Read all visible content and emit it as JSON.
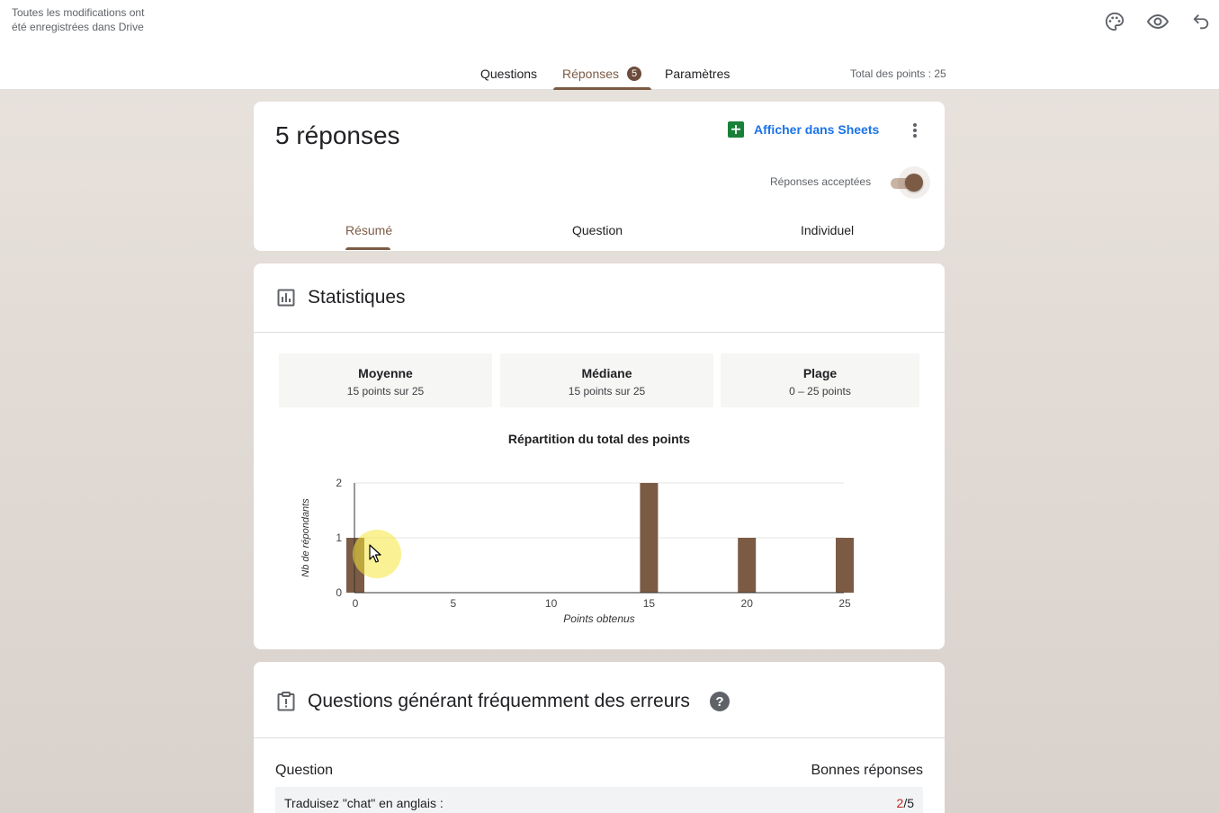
{
  "header": {
    "save_status": "Toutes les modifications ont été enregistrées dans Drive",
    "tabs": [
      {
        "label": "Questions"
      },
      {
        "label": "Réponses",
        "badge": "5"
      },
      {
        "label": "Paramètres"
      }
    ],
    "total_points": "Total des points : 25",
    "icons": [
      "palette-icon",
      "eye-icon",
      "undo-icon"
    ]
  },
  "responses": {
    "count_title": "5 réponses",
    "sheets_label": "Afficher dans Sheets",
    "accept_label": "Réponses acceptées",
    "accepting": true,
    "subtabs": [
      "Résumé",
      "Question",
      "Individuel"
    ],
    "active_subtab": "Résumé"
  },
  "stats": {
    "title": "Statistiques",
    "boxes": [
      {
        "name": "Moyenne",
        "value": "15 points sur 25"
      },
      {
        "name": "Médiane",
        "value": "15 points sur 25"
      },
      {
        "name": "Plage",
        "value": "0 – 25 points"
      }
    ]
  },
  "chart_data": {
    "type": "bar",
    "title": "Répartition du total des points",
    "xlabel": "Points obtenus",
    "ylabel": "Nb de répondants",
    "x": [
      0,
      15,
      20,
      25
    ],
    "values": [
      1,
      2,
      1,
      1
    ],
    "x_ticks": [
      0,
      5,
      10,
      15,
      20,
      25
    ],
    "y_ticks": [
      0,
      1,
      2
    ],
    "xlim": [
      0,
      25
    ],
    "ylim": [
      0,
      2
    ],
    "bar_color": "#7c5b45",
    "grid": true
  },
  "errors": {
    "title": "Questions générant fréquemment des erreurs",
    "col_question": "Question",
    "col_correct": "Bonnes réponses",
    "rows": [
      {
        "question": "Traduisez \"chat\" en anglais :",
        "correct": "2",
        "total": "/5"
      }
    ]
  },
  "colors": {
    "accent": "#7c5b45",
    "link": "#1a73e8",
    "sheets_green": "#188038"
  }
}
